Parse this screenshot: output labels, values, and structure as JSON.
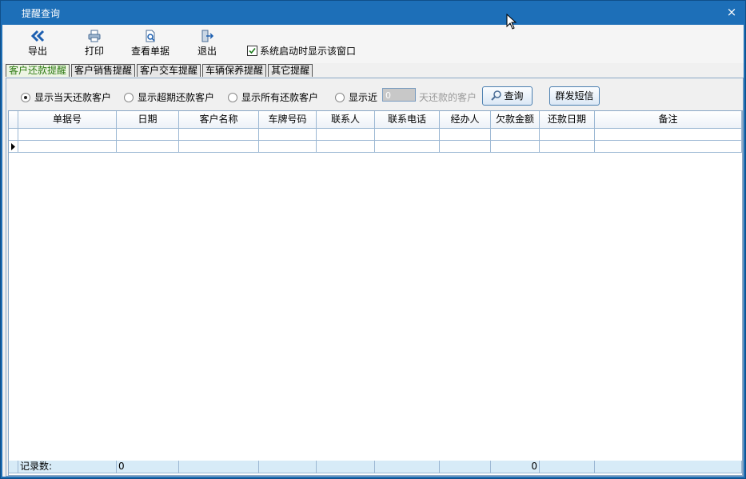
{
  "window": {
    "title": "提醒查询",
    "close": "×"
  },
  "toolbar": {
    "buttons": [
      {
        "label": "导出",
        "icon": "double-chevron-left-icon"
      },
      {
        "label": "打印",
        "icon": "printer-icon"
      },
      {
        "label": "查看单据",
        "icon": "document-search-icon"
      },
      {
        "label": "退出",
        "icon": "exit-door-icon"
      }
    ],
    "startup_check": {
      "label": "系统启动时显示该窗口",
      "checked": true
    }
  },
  "tabs": [
    {
      "label": "客户还款提醒",
      "active": true
    },
    {
      "label": "客户销售提醒"
    },
    {
      "label": "客户交车提醒"
    },
    {
      "label": "车辆保养提醒"
    },
    {
      "label": "其它提醒"
    }
  ],
  "filters": {
    "options": [
      {
        "label": "显示当天还款客户",
        "selected": true
      },
      {
        "label": "显示超期还款客户",
        "selected": false
      },
      {
        "label": "显示所有还款客户",
        "selected": false
      },
      {
        "label": "显示近",
        "selected": false
      }
    ],
    "days_value": "0",
    "days_suffix": "天还款的客户",
    "query_label": "查询",
    "sms_label": "群发短信"
  },
  "grid": {
    "columns": [
      "单据号",
      "日期",
      "客户名称",
      "车牌号码",
      "联系人",
      "联系电话",
      "经办人",
      "欠款金额",
      "还款日期",
      "备注"
    ],
    "footer": {
      "label": "记录数:",
      "count": "0",
      "amount_total": "0"
    }
  },
  "colors": {
    "title_bar": "#1d6fb8",
    "active_tab_text": "#2d7a12",
    "grid_line": "#9bb7d3",
    "footer_bg": "#d7ebf7"
  }
}
